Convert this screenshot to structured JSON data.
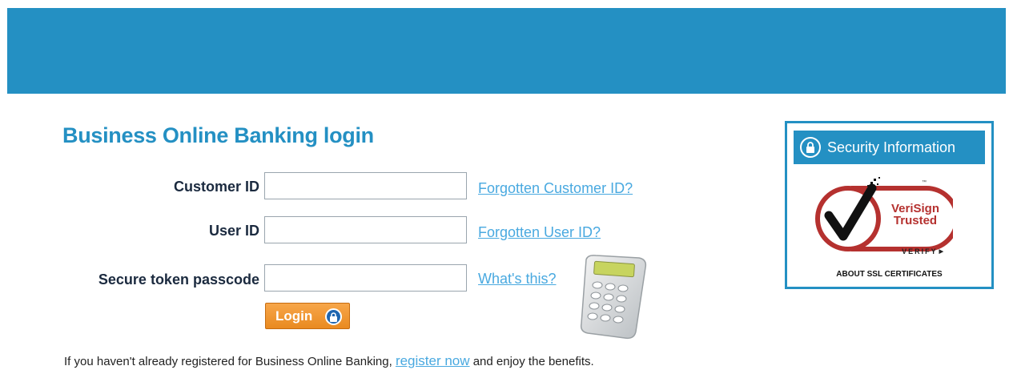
{
  "colors": {
    "brand_blue": "#2490c3",
    "link": "#49a9e0",
    "button_orange": "#f29a35",
    "label_text": "#1b2a3f"
  },
  "login": {
    "title": "Business Online Banking login",
    "fields": [
      {
        "label": "Customer ID",
        "value": "",
        "link": "Forgotten Customer ID?"
      },
      {
        "label": "User ID",
        "value": "",
        "link": "Forgotten User ID?"
      },
      {
        "label": "Secure token passcode",
        "value": "",
        "link": "What's this?"
      }
    ],
    "button_label": "Login"
  },
  "footer": {
    "text_before": "If you haven't already registered for Business Online Banking, ",
    "register_link": "register now",
    "text_after": " and enjoy the benefits."
  },
  "security": {
    "title": "Security Information",
    "seal_brand_line1": "VeriSign",
    "seal_brand_line2": "Trusted",
    "seal_verify": "VERIFY",
    "about": "ABOUT SSL CERTIFICATES"
  },
  "icons": [
    "lock-icon",
    "shield-lock-icon",
    "security-token-icon",
    "verisign-check-icon",
    "play-arrow-icon"
  ]
}
